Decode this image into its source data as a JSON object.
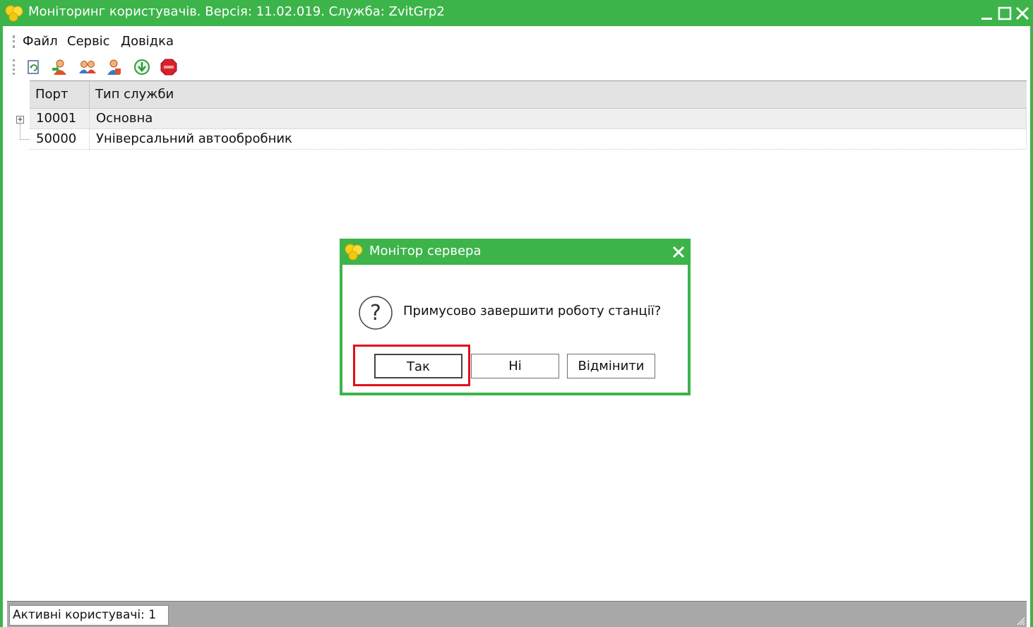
{
  "window": {
    "title": "Моніторинг користувачів. Версія: 11.02.019. Служба: ZvitGrp2"
  },
  "menu": {
    "items": [
      "Файл",
      "Сервіс",
      "Довідка"
    ]
  },
  "toolbar": {
    "buttons": [
      "refresh-icon",
      "user-connect-icon",
      "users-icon",
      "user-icon",
      "download-icon",
      "stop-icon"
    ]
  },
  "grid": {
    "columns": [
      "Порт",
      "Тип служби"
    ],
    "rows": [
      {
        "port": "10001",
        "type": "Основна"
      },
      {
        "port": "50000",
        "type": "Універсальний автообробник"
      }
    ]
  },
  "status": {
    "active_users": "Активні користувачі: 1"
  },
  "dialog": {
    "title": "Монітор сервера",
    "message": "Примусово завершити роботу станції?",
    "buttons": {
      "yes": "Так",
      "no": "Ні",
      "cancel": "Відмінити"
    }
  },
  "colors": {
    "title_bar": "#3cb44a",
    "highlight": "#e0101a",
    "status_bar": "#a8a8a8"
  }
}
